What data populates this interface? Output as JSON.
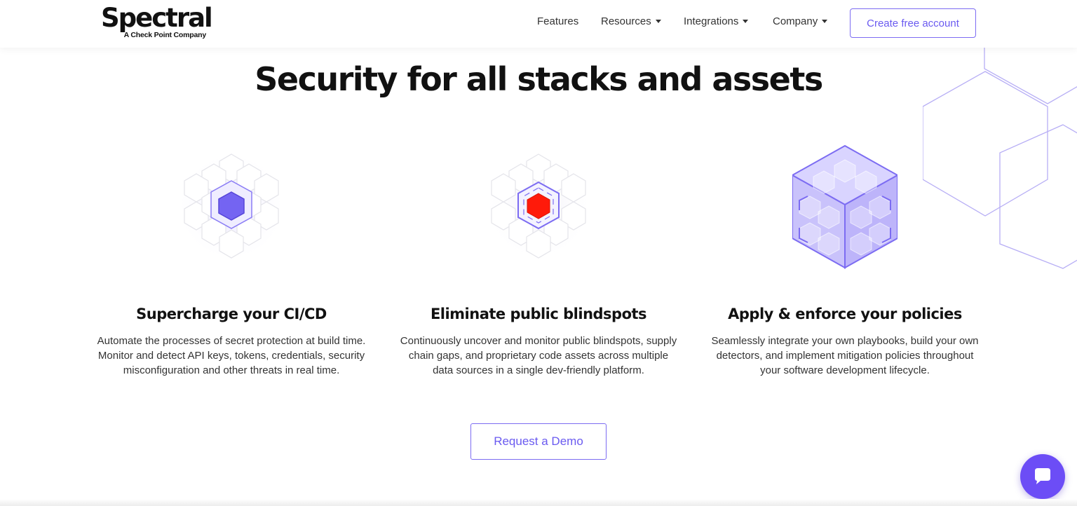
{
  "brand": {
    "name": "Spectral",
    "tagline": "A Check Point Company"
  },
  "nav": {
    "items": [
      {
        "label": "Features",
        "has_dropdown": false
      },
      {
        "label": "Resources",
        "has_dropdown": true
      },
      {
        "label": "Integrations",
        "has_dropdown": true
      },
      {
        "label": "Company",
        "has_dropdown": true
      }
    ],
    "cta_label": "Create free account"
  },
  "hero": {
    "title": "Security for all stacks and assets"
  },
  "features": [
    {
      "icon": "hexagon-cluster-purple-icon",
      "title": "Supercharge your CI/CD",
      "text": "Automate the processes of secret protection at build time. Monitor and detect API keys, tokens, credentials, security misconfiguration and other threats in real time."
    },
    {
      "icon": "hexagon-cluster-red-target-icon",
      "title": "Eliminate public blindspots",
      "text": "Continuously uncover and monitor public blindspots, supply chain gaps, and proprietary code assets across multiple data sources in a single dev-friendly platform."
    },
    {
      "icon": "policy-cube-icon",
      "title": "Apply & enforce your policies",
      "text": "Seamlessly integrate your own playbooks, build your own detectors, and implement mitigation policies throughout your software development lifecycle."
    }
  ],
  "demo_button": {
    "label": "Request a Demo"
  },
  "colors": {
    "accent": "#6a5af0",
    "alert": "#ff1a0a",
    "text": "#111111"
  },
  "chat": {
    "icon": "chat-bubble-icon"
  }
}
